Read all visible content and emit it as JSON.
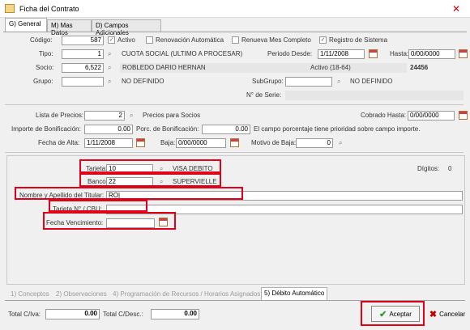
{
  "window": {
    "title": "Ficha del Contrato"
  },
  "top_tabs": [
    "G) General",
    "M) Mas Datos",
    "D) Campos Adicionales"
  ],
  "general": {
    "codigo_label": "Código:",
    "codigo_value": "587",
    "activo_label": "Activo",
    "renovacion_label": "Renovación Automática",
    "renueva_label": "Renueva Mes Completo",
    "registro_label": "Registro de Sistema",
    "tipo_label": "Tipo:",
    "tipo_value": "1",
    "tipo_desc": "CUOTA SOCIAL (ULTIMO A PROCESAR)",
    "periodo_desde_label": "Periodo Desde:",
    "periodo_desde_value": "1/11/2008",
    "hasta_label": "Hasta:",
    "hasta_value": "0/00/0000",
    "socio_label": "Socio:",
    "socio_value": "6,522",
    "socio_name": "ROBLEDO DARIO HERNAN",
    "socio_status": "Activo (18-64)",
    "socio_num": "24456",
    "grupo_label": "Grupo:",
    "grupo_desc": "NO DEFINIDO",
    "subgrupo_label": "SubGrupo:",
    "subgrupo_desc": "NO DEFINIDO",
    "serie_label": "N° de Serie:",
    "lista_label": "Lista de Precios:",
    "lista_value": "2",
    "lista_desc": "Precios para Socios",
    "cobrado_label": "Cobrado Hasta:",
    "cobrado_value": "0/00/0000",
    "importe_label": "Importe de Bonificación:",
    "importe_value": "0.00",
    "porc_label": "Porc. de Bonificación:",
    "porc_value": "0.00",
    "porc_note": "El campo porcentaje tiene prioridad sobre campo importe.",
    "alta_label": "Fecha de Alta:",
    "alta_value": "1/11/2008",
    "baja_label": "Baja:",
    "baja_value": "0/00/0000",
    "motivo_label": "Motivo de Baja:",
    "motivo_value": "0"
  },
  "debito": {
    "tarjeta_label": "Tarjeta:",
    "tarjeta_value": "10",
    "tarjeta_desc": "VISA DEBITO",
    "digitos_label": "Dígitos:",
    "digitos_value": "0",
    "banco_label": "Banco:",
    "banco_value": "22",
    "banco_desc": "SUPERVIELLE",
    "nombre_label": "Nombre y Apellido del Titular:",
    "nombre_value": "RO|",
    "cbu_label": "Tarjeta N° / CBU:",
    "cbu_value": "",
    "venc_label": "Fecha Vencimiento:",
    "venc_value": ""
  },
  "bottom_tabs": [
    "1) Conceptos",
    "2) Observaciones",
    "4) Programación de Recursos / Horarios Asignados",
    "5) Débito Automático"
  ],
  "footer": {
    "total_iva_label": "Total C/Iva:",
    "total_iva_value": "0.00",
    "total_desc_label": "Total C/Desc.:",
    "total_desc_value": "0.00",
    "aceptar_label": "Aceptar",
    "cancelar_label": "Cancelar"
  },
  "colors": {
    "highlight": "#e0001a",
    "accent_ok": "#2e9a2e",
    "cancel": "#c00000"
  }
}
